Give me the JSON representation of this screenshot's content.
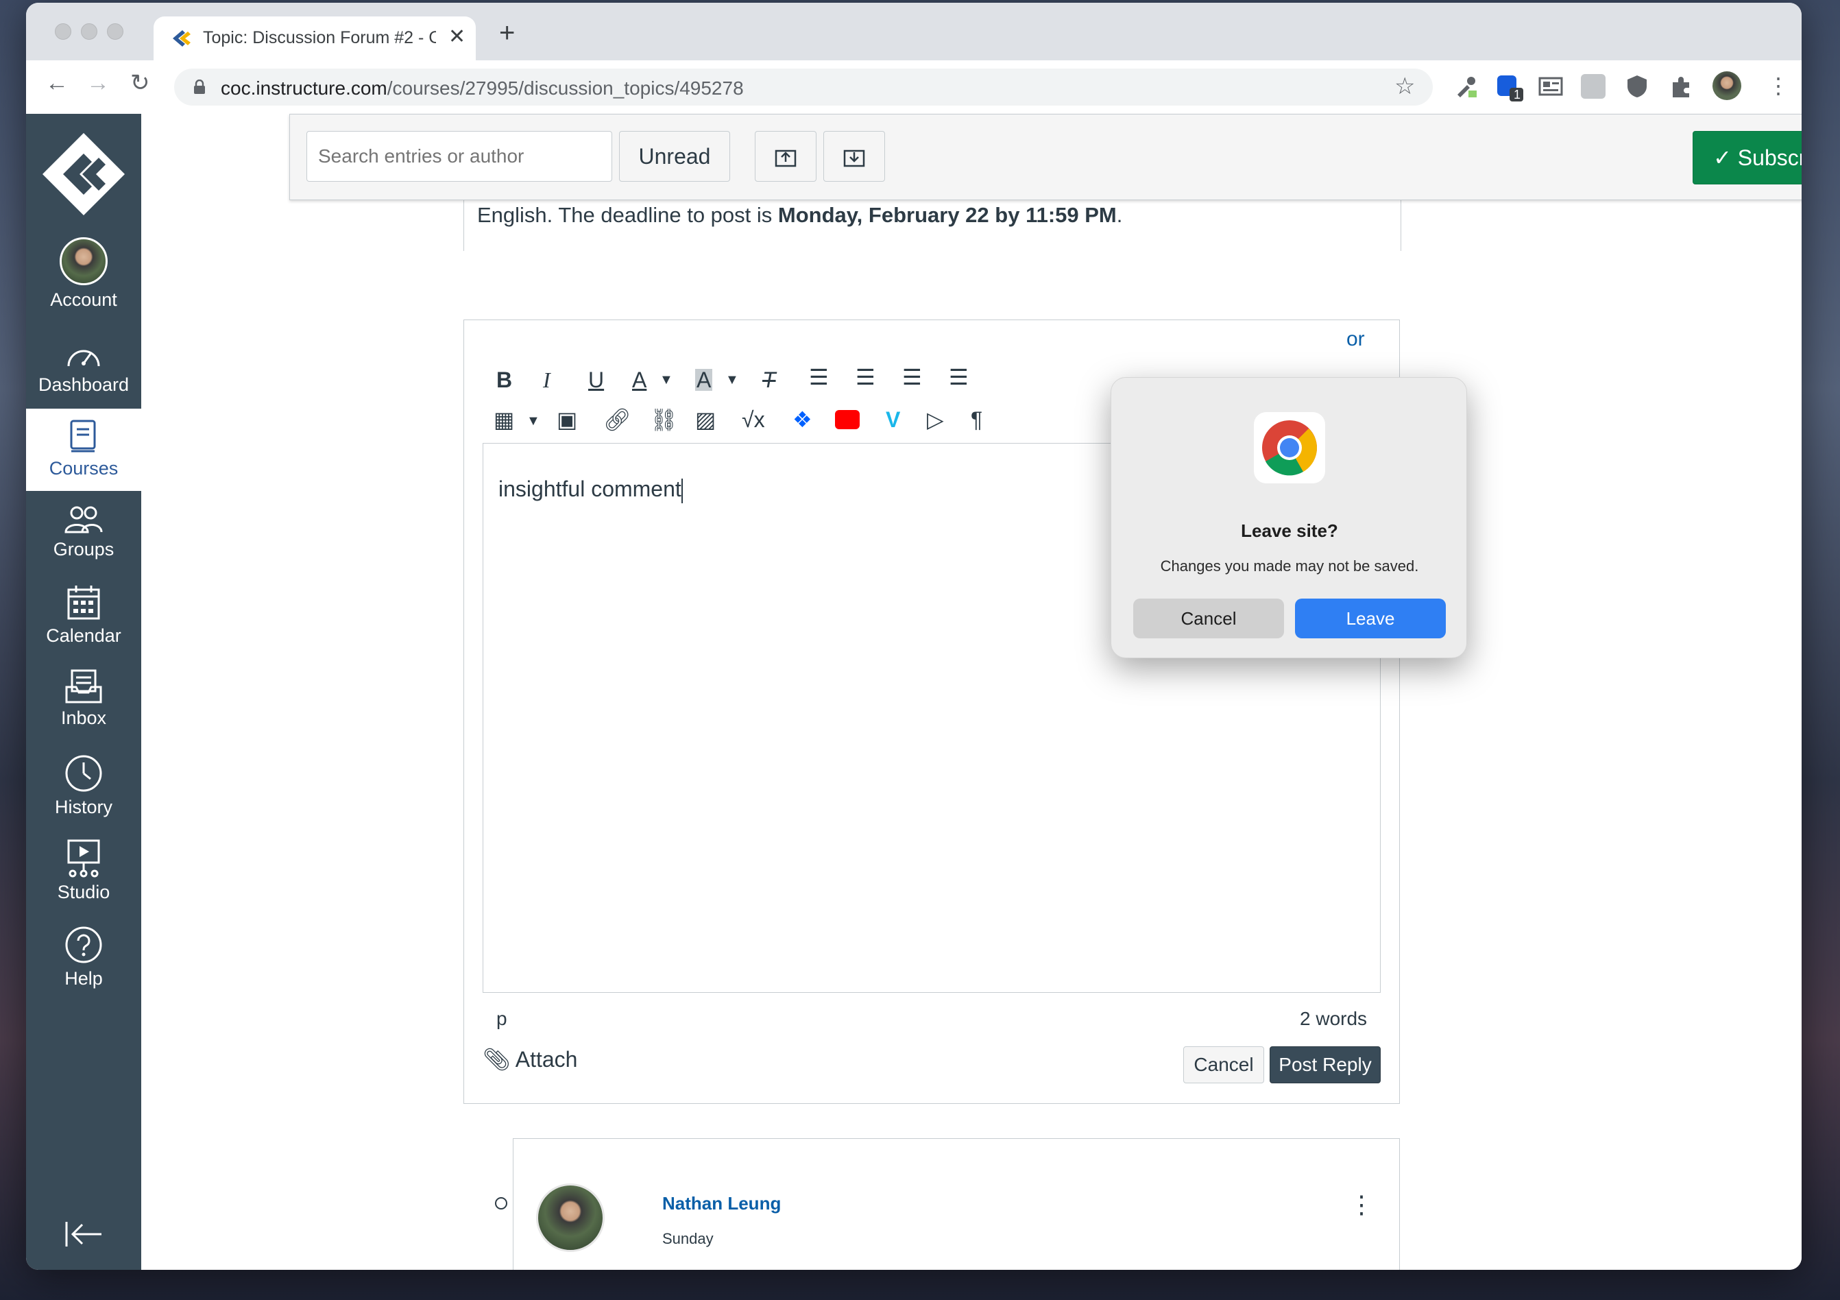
{
  "browser": {
    "tab_title": "Topic: Discussion Forum #2 - C",
    "new_tab_icon": "plus-icon",
    "url_host": "coc.instructure.com",
    "url_path": "/courses/27995/discussion_topics/495278",
    "extension_badge": "1"
  },
  "sidebar": {
    "items": [
      {
        "label": "Account"
      },
      {
        "label": "Dashboard"
      },
      {
        "label": "Courses"
      },
      {
        "label": "Groups"
      },
      {
        "label": "Calendar"
      },
      {
        "label": "Inbox"
      },
      {
        "label": "History"
      },
      {
        "label": "Studio"
      },
      {
        "label": "Help"
      }
    ]
  },
  "toolbar": {
    "search_placeholder": "Search entries or author",
    "unread_label": "Unread",
    "subscribed_label": "Subscribed"
  },
  "post": {
    "text_start": "English. The deadline to post is ",
    "deadline": "Monday, February 22 by 11:59 PM",
    "text_end": "."
  },
  "editor": {
    "content": "insightful comment",
    "path": "p",
    "word_count": "2 words",
    "attach_label": "Attach",
    "cancel_label": "Cancel",
    "post_label": "Post Reply",
    "partial_link": "or"
  },
  "comment": {
    "author": "Nathan Leung",
    "date": "Sunday"
  },
  "dialog": {
    "title": "Leave site?",
    "message": "Changes you made may not be saved.",
    "cancel_label": "Cancel",
    "leave_label": "Leave"
  },
  "colors": {
    "canvas_sidebar": "#394b58",
    "subscribed_green": "#0b874b",
    "leave_blue": "#2f7ff3",
    "author_link": "#0a5fa8"
  }
}
